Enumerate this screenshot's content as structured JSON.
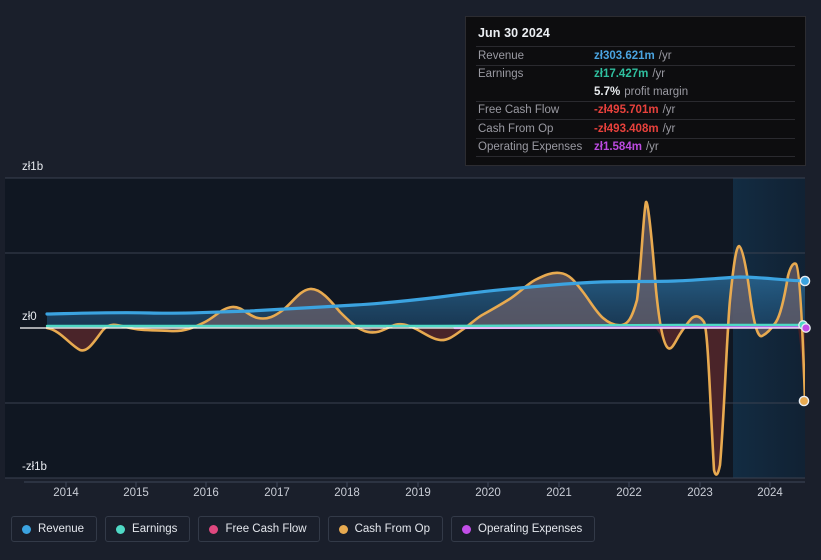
{
  "tooltip": {
    "date": "Jun 30 2024",
    "rows": [
      {
        "label": "Revenue",
        "value": "zł303.621m",
        "unit": "/yr",
        "color": "#4aa3e0"
      },
      {
        "label": "Earnings",
        "value": "zł17.427m",
        "unit": "/yr",
        "color": "#2fbf9f"
      },
      {
        "label": "Free Cash Flow",
        "value": "-zł495.701m",
        "unit": "/yr",
        "color": "#e8413c"
      },
      {
        "label": "Cash From Op",
        "value": "-zł493.408m",
        "unit": "/yr",
        "color": "#e8413c"
      },
      {
        "label": "Operating Expenses",
        "value": "zł1.584m",
        "unit": "/yr",
        "color": "#bc4ae0"
      }
    ],
    "margin_value": "5.7%",
    "margin_label": "profit margin"
  },
  "legend": [
    {
      "label": "Revenue",
      "color": "#3ba3e0"
    },
    {
      "label": "Earnings",
      "color": "#4fd9c5"
    },
    {
      "label": "Free Cash Flow",
      "color": "#e0487f"
    },
    {
      "label": "Cash From Op",
      "color": "#e8aa50"
    },
    {
      "label": "Operating Expenses",
      "color": "#c24ee8"
    }
  ],
  "chart_data": {
    "type": "line",
    "title": "",
    "xlabel": "",
    "ylabel": "",
    "ylim": [
      -1000000000,
      1000000000
    ],
    "ytick_labels": [
      "zł1b",
      "zł0",
      "-zł1b"
    ],
    "ytick_values": [
      1000000000,
      0,
      -1000000000
    ],
    "grid": true,
    "legend_position": "bottom",
    "currency": "zł",
    "categories": [
      "2014",
      "2015",
      "2016",
      "2017",
      "2018",
      "2019",
      "2020",
      "2021",
      "2022",
      "2023",
      "2024"
    ],
    "x": [
      2013.5,
      2014,
      2014.5,
      2015,
      2015.5,
      2016,
      2016.5,
      2017,
      2017.5,
      2018,
      2018.5,
      2019,
      2019.5,
      2020,
      2020.5,
      2021,
      2021.5,
      2022,
      2022.5,
      2023,
      2023.5,
      2024,
      2024.5
    ],
    "series": [
      {
        "name": "Revenue",
        "color": "#3ba3e0",
        "values": [
          105,
          107,
          108,
          106,
          104,
          105,
          108,
          112,
          114,
          116,
          118,
          122,
          130,
          145,
          160,
          178,
          190,
          196,
          200,
          215,
          250,
          290,
          304
        ],
        "unit": "m",
        "last_value": "zł303.621m"
      },
      {
        "name": "Earnings",
        "color": "#4fd9c5",
        "values": [
          8,
          9,
          7,
          6,
          8,
          10,
          9,
          8,
          7,
          9,
          11,
          10,
          9,
          12,
          14,
          13,
          12,
          11,
          10,
          12,
          14,
          16,
          17
        ],
        "unit": "m",
        "last_value": "zł17.427m"
      },
      {
        "name": "Free Cash Flow",
        "color": "#e0487f",
        "values": [
          null,
          null,
          null,
          null,
          null,
          null,
          null,
          null,
          null,
          null,
          null,
          null,
          null,
          null,
          null,
          null,
          null,
          null,
          null,
          null,
          null,
          null,
          -496
        ],
        "unit": "m",
        "last_value": "-zł495.701m"
      },
      {
        "name": "Cash From Op",
        "color": "#e8aa50",
        "values": [
          -5,
          -295,
          30,
          5,
          -10,
          60,
          -20,
          10,
          -25,
          75,
          180,
          25,
          -130,
          40,
          120,
          300,
          -40,
          840,
          -80,
          -960,
          560,
          -60,
          -493
        ],
        "unit": "m",
        "last_value": "-zł493.408m"
      },
      {
        "name": "Operating Expenses",
        "color": "#c24ee8",
        "values": [
          null,
          null,
          null,
          null,
          null,
          null,
          null,
          null,
          null,
          2,
          2,
          2,
          2,
          2,
          2,
          2,
          2,
          2,
          2,
          2,
          2,
          2,
          1.584
        ],
        "unit": "m",
        "last_value": "zł1.584m"
      }
    ],
    "forecast_band": {
      "start_year": 2023.7,
      "end_year": 2024.75
    }
  }
}
